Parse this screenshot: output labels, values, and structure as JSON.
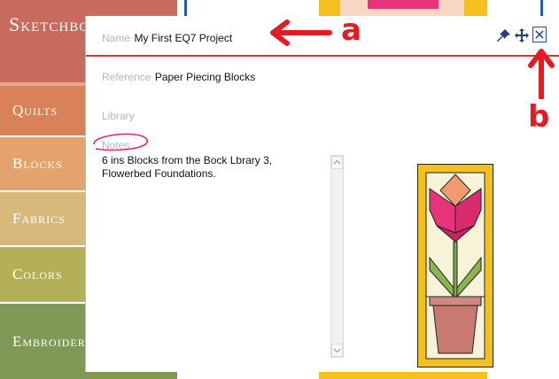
{
  "sidebar": {
    "header": "Sketchbook",
    "items": [
      {
        "label": "Quilts"
      },
      {
        "label": "Blocks"
      },
      {
        "label": "Fabrics"
      },
      {
        "label": "Colors"
      },
      {
        "label": "Embroidery"
      }
    ]
  },
  "popup": {
    "name_label": "Name",
    "name_value": "My First EQ7 Project",
    "reference_label": "Reference",
    "reference_value": "Paper Piecing Blocks",
    "library_label": "Library",
    "notes_label": "Notes",
    "notes_text": "6 ins Blocks from the Bock Lbrary 3, Flowerbed Foundations."
  },
  "annotations": {
    "a": "a",
    "b": "b"
  },
  "icons": {
    "pin": "pin-icon",
    "move": "move-icon",
    "close": "close-icon"
  },
  "colors": {
    "annotation": "#e31b23",
    "block_border": "#f4c020",
    "tulip": "#e8337a",
    "pot": "#c97a70",
    "leaf": "#7fa84a"
  }
}
